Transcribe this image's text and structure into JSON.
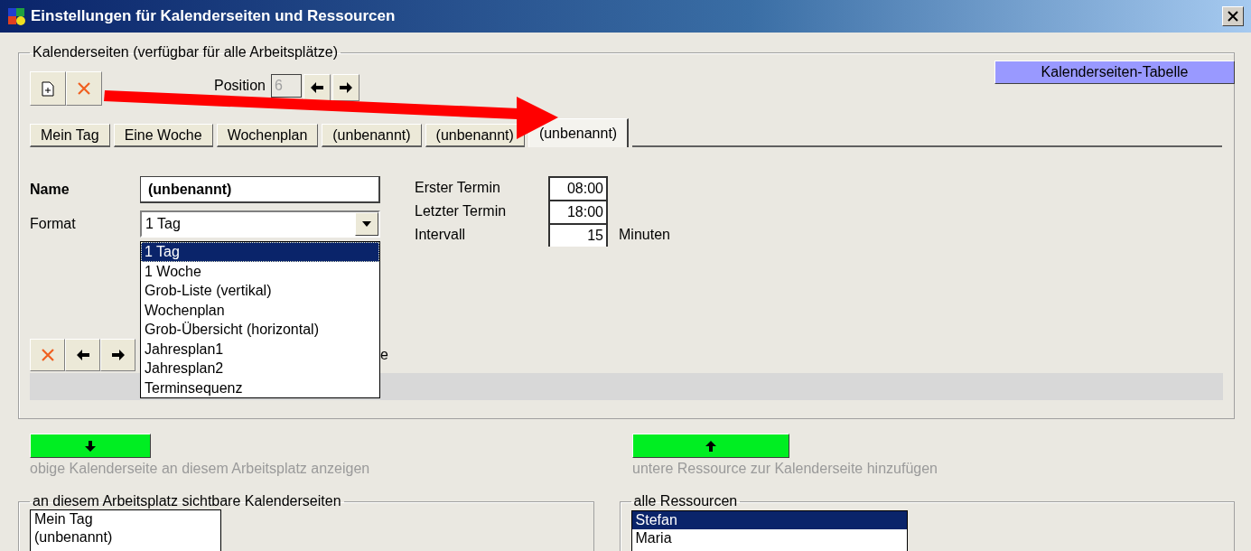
{
  "window": {
    "title": "Einstellungen für Kalenderseiten und Ressourcen"
  },
  "calendar_pages": {
    "legend": "Kalenderseiten (verfügbar für alle Arbeitsplätze)",
    "position_label": "Position",
    "position_value": "6",
    "table_button": "Kalenderseiten-Tabelle",
    "tabs": [
      {
        "label": "Mein Tag",
        "selected": false
      },
      {
        "label": "Eine Woche",
        "selected": false
      },
      {
        "label": "Wochenplan",
        "selected": false
      },
      {
        "label": "(unbenannt)",
        "selected": false
      },
      {
        "label": "(unbenannt)",
        "selected": false
      },
      {
        "label": "(unbenannt)",
        "selected": true
      }
    ],
    "name_label": "Name",
    "name_value": "(unbenannt)",
    "format_label": "Format",
    "format_value": "1 Tag",
    "format_options": [
      {
        "label": "1 Tag",
        "selected": true
      },
      {
        "label": "1 Woche",
        "selected": false
      },
      {
        "label": "Grob-Liste (vertikal)",
        "selected": false
      },
      {
        "label": "Wochenplan",
        "selected": false
      },
      {
        "label": "Grob-Übersicht (horizontal)",
        "selected": false
      },
      {
        "label": "Jahresplan1",
        "selected": false
      },
      {
        "label": "Jahresplan2",
        "selected": false
      },
      {
        "label": "Terminsequenz",
        "selected": false
      }
    ],
    "times": [
      {
        "label": "Erster Termin",
        "value": "08:00"
      },
      {
        "label": "Letzter Termin",
        "value": "18:00"
      },
      {
        "label": "Intervall",
        "value": "15",
        "unit": "Minuten"
      }
    ],
    "toolbar_label_tail": "e"
  },
  "actions": [
    {
      "kind": "down",
      "label": "obige Kalenderseite an diesem Arbeitsplatz anzeigen"
    },
    {
      "kind": "up",
      "label": "untere Ressource zur Kalenderseite hinzufügen"
    }
  ],
  "visible_pages": {
    "legend": "an diesem Arbeitsplatz sichtbare Kalenderseiten",
    "items": [
      {
        "label": "Mein Tag",
        "selected": false
      },
      {
        "label": "(unbenannt)",
        "selected": false
      }
    ]
  },
  "resources": {
    "legend": "alle Ressourcen",
    "items": [
      {
        "label": "Stefan",
        "selected": true
      },
      {
        "label": "Maria",
        "selected": false
      }
    ]
  }
}
